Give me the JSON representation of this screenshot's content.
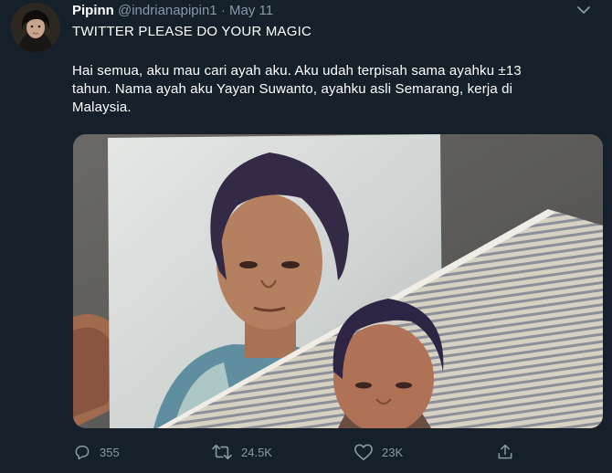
{
  "tweet": {
    "author_name": "Pipinn",
    "author_handle": "@indrianapipin1",
    "separator": "·",
    "date": "May 11",
    "headline": "TWITTER PLEASE DO YOUR MAGIC",
    "body_lines": [
      "Hai semua, aku mau cari ayah aku. Aku udah terpisah sama ayahku ±13",
      "tahun. Nama ayah aku Yayan Suwanto, ayahku asli Semarang, kerja di",
      "Malaysia."
    ]
  },
  "actions": {
    "reply_count": "355",
    "retweet_count": "24.5K",
    "like_count": "23K"
  },
  "icons": {
    "more": "chevron-down-icon",
    "reply": "reply-icon",
    "retweet": "retweet-icon",
    "like": "heart-icon",
    "share": "share-icon"
  },
  "colors": {
    "background": "#15202b",
    "text_primary": "#ffffff",
    "text_secondary": "#8899a6"
  }
}
